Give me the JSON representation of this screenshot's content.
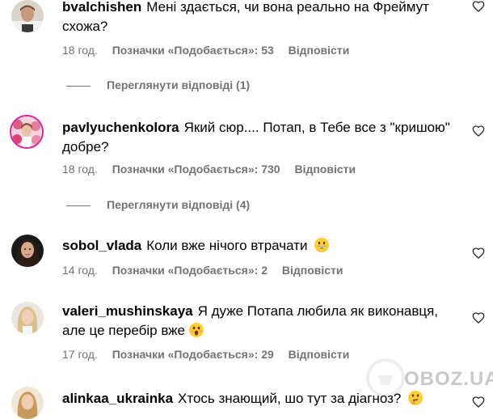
{
  "comments": [
    {
      "username": "bvalchishen",
      "text": "Мені здається, чи вона реально на Фреймут схожа?",
      "time": "18 год.",
      "likes": "Позначки «Подобається»: 53",
      "reply": "Відповісти",
      "view_replies": "Переглянути відповіді (1)",
      "avatar_icon": "man-avatar"
    },
    {
      "username": "pavlyuchenkolora",
      "text": "Який сюр.... Потап, в Тебе все з \"кришою\" добре?",
      "time": "18 год.",
      "likes": "Позначки «Подобається»: 730",
      "reply": "Відповісти",
      "view_replies": "Переглянути відповіді (4)",
      "avatar_icon": "woman-with-flowers-avatar"
    },
    {
      "username": "sobol_vlada",
      "text": "Коли вже нічого втрачати",
      "time": "14 год.",
      "likes": "Позначки «Подобається»: 2",
      "reply": "Відповісти",
      "emoji": "grinning-face-emoji",
      "avatar_icon": "woman-dark-hair-avatar"
    },
    {
      "username": "valeri_mushinskaya",
      "text": "Я дуже Потапа любила як виконавця, але це перебір вже",
      "time": "17 год.",
      "likes": "Позначки «Подобається»: 29",
      "reply": "Відповісти",
      "emoji": "shocked-face-emoji",
      "avatar_icon": "woman-blonde-avatar"
    },
    {
      "username": "alinkaa_ukrainka",
      "text": "Хтось знающий, шо тут за діагноз?",
      "emoji": "thinking-face-emoji",
      "avatar_icon": "woman-light-hair-avatar"
    }
  ],
  "watermark": "OBOZ.UA",
  "colors": {
    "text": "#000000",
    "meta": "#737373"
  }
}
